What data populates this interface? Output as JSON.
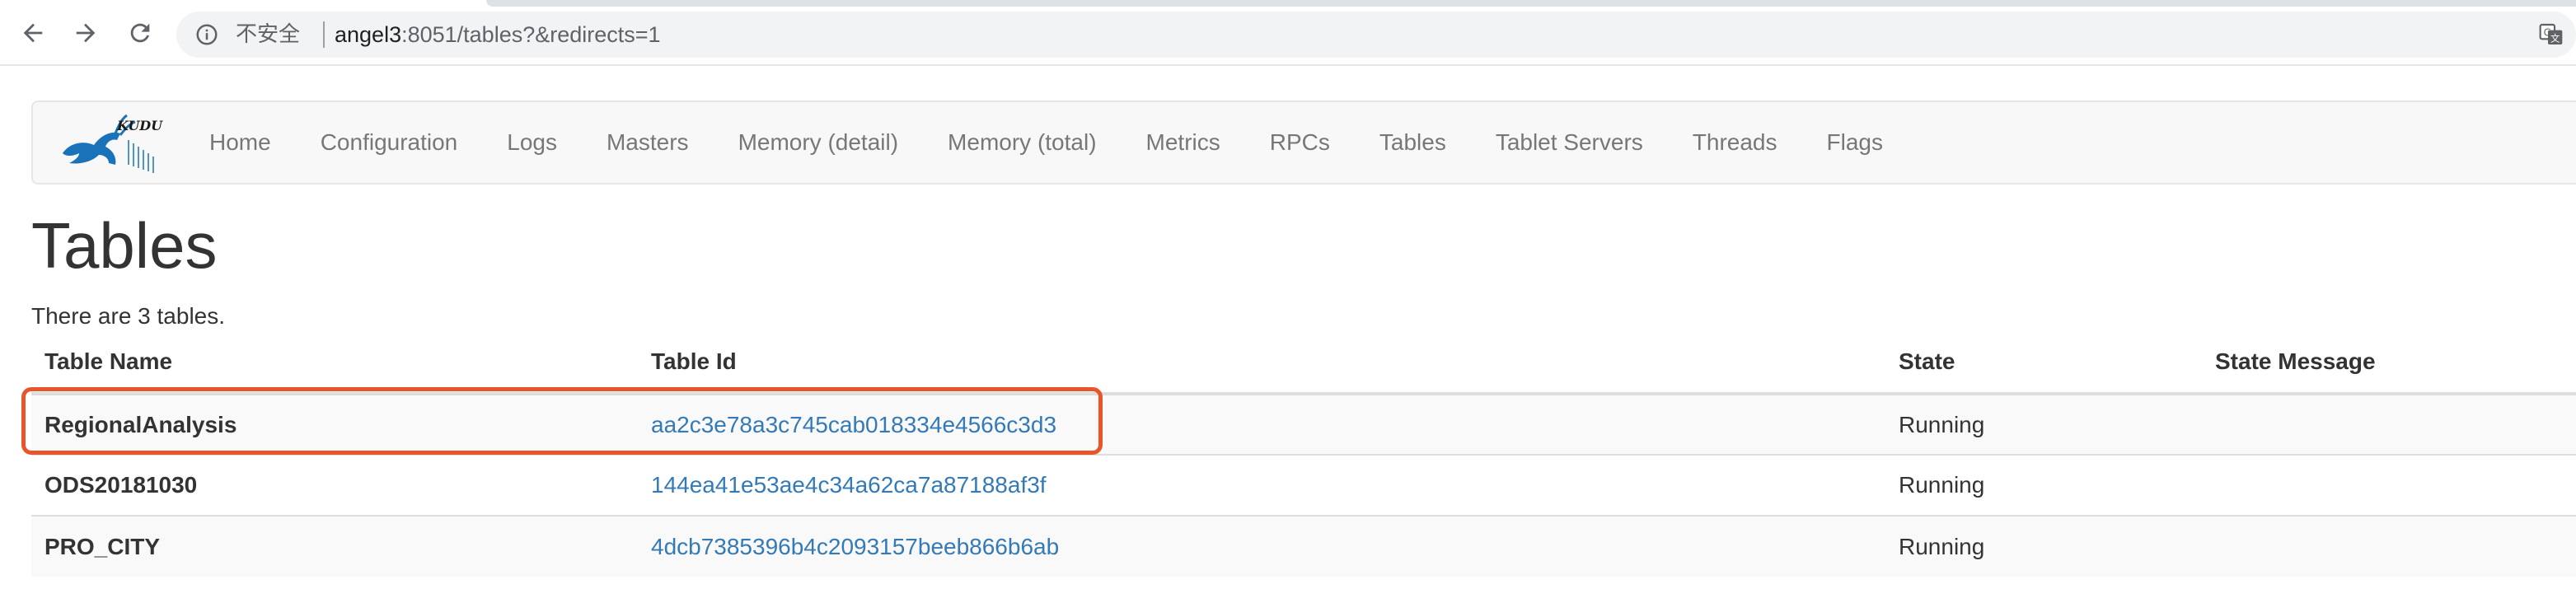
{
  "browser": {
    "security_label": "不安全",
    "url_host": "angel3",
    "url_rest": ":8051/tables?&redirects=1"
  },
  "navbar": {
    "brand_text": "KUDU",
    "links": [
      "Home",
      "Configuration",
      "Logs",
      "Masters",
      "Memory (detail)",
      "Memory (total)",
      "Metrics",
      "RPCs",
      "Tables",
      "Tablet Servers",
      "Threads",
      "Flags"
    ]
  },
  "page": {
    "title": "Tables",
    "summary": "There are 3 tables."
  },
  "table": {
    "headers": [
      "Table Name",
      "Table Id",
      "State",
      "State Message"
    ],
    "rows": [
      {
        "name": "RegionalAnalysis",
        "id": "aa2c3e78a3c745cab018334e4566c3d3",
        "state": "Running",
        "message": ""
      },
      {
        "name": "ODS20181030",
        "id": "144ea41e53ae4c34a62ca7a87188af3f",
        "state": "Running",
        "message": ""
      },
      {
        "name": "PRO_CITY",
        "id": "4dcb7385396b4c2093157beeb866b6ab",
        "state": "Running",
        "message": ""
      }
    ]
  },
  "colors": {
    "link": "#337ab7",
    "highlight": "#e8552b",
    "kudu_blue": "#1a73b8"
  },
  "icons": {
    "back": "arrow-left-icon",
    "forward": "arrow-right-icon",
    "reload": "reload-icon",
    "info": "info-circle-icon",
    "translate": "translate-icon",
    "logo": "kudu-logo"
  }
}
